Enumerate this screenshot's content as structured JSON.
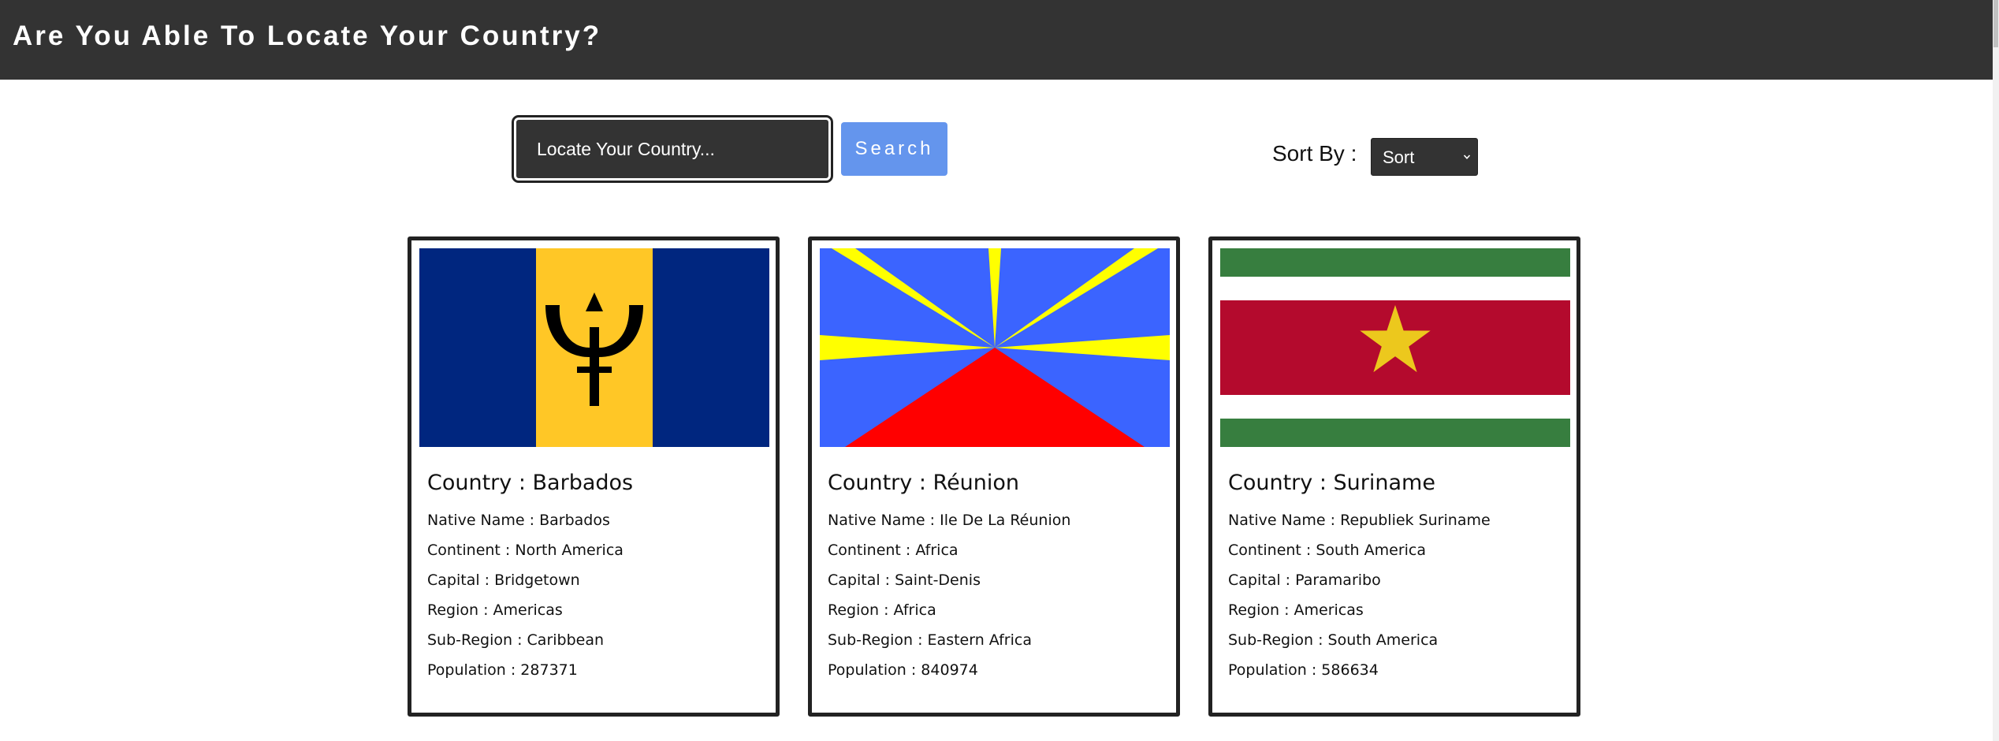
{
  "header": {
    "title": "Are You Able To Locate Your Country?"
  },
  "search": {
    "placeholder": "Locate Your Country...",
    "button_label": "Search"
  },
  "sort": {
    "label": "Sort By :",
    "selected": "Sort",
    "chevron_icon": "chevron-down-icon"
  },
  "colors": {
    "header_bg": "#333333",
    "button_bg": "#6495ed",
    "card_border": "#222222"
  },
  "cards": [
    {
      "flag_icon": "barbados-flag",
      "country": "Country : Barbados",
      "native_name": "Native Name : Barbados",
      "continent": "Continent : North America",
      "capital": "Capital : Bridgetown",
      "region": "Region : Americas",
      "sub_region": "Sub-Region : Caribbean",
      "population": "Population : 287371"
    },
    {
      "flag_icon": "reunion-flag",
      "country": "Country : Réunion",
      "native_name": "Native Name : Ile De La Réunion",
      "continent": "Continent : Africa",
      "capital": "Capital : Saint-Denis",
      "region": "Region : Africa",
      "sub_region": "Sub-Region : Eastern Africa",
      "population": "Population : 840974"
    },
    {
      "flag_icon": "suriname-flag",
      "country": "Country : Suriname",
      "native_name": "Native Name : Republiek Suriname",
      "continent": "Continent : South America",
      "capital": "Capital : Paramaribo",
      "region": "Region : Americas",
      "sub_region": "Sub-Region : South America",
      "population": "Population : 586634"
    }
  ]
}
